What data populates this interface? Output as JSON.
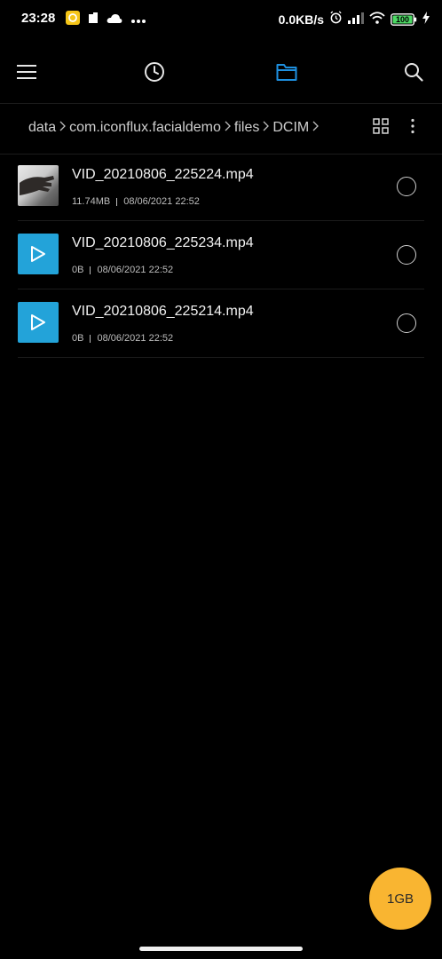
{
  "status_bar": {
    "time": "23:28",
    "net_speed": "0.0KB/s",
    "battery": "100",
    "battery_color": "#4cd964"
  },
  "toolbar": {
    "menu_icon": "menu-icon",
    "recent_icon": "clock-icon",
    "files_icon": "folder-icon",
    "search_icon": "search-icon",
    "accent": "#1e90e0"
  },
  "breadcrumb": {
    "items": [
      "data",
      "com.iconflux.facialdemo",
      "files",
      "DCIM"
    ]
  },
  "files": [
    {
      "name": "VID_20210806_225224.mp4",
      "size": "11.74MB",
      "date": "08/06/2021 22:52",
      "thumb": "photo"
    },
    {
      "name": "VID_20210806_225234.mp4",
      "size": "0B",
      "date": "08/06/2021 22:52",
      "thumb": "video"
    },
    {
      "name": "VID_20210806_225214.mp4",
      "size": "0B",
      "date": "08/06/2021 22:52",
      "thumb": "video"
    }
  ],
  "storage_button": {
    "label": "1GB",
    "color": "#f9b531"
  }
}
